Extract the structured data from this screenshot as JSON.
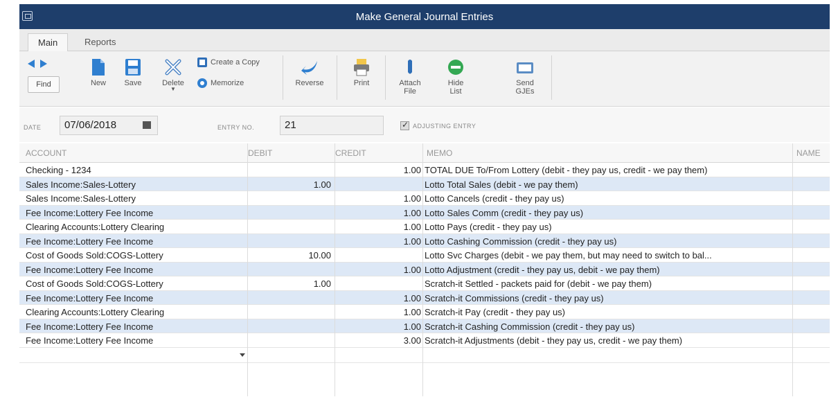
{
  "window": {
    "title": "Make General Journal Entries"
  },
  "tabs": [
    {
      "label": "Main"
    },
    {
      "label": "Reports"
    }
  ],
  "toolbar": {
    "find": "Find",
    "new": "New",
    "save": "Save",
    "delete": "Delete",
    "create_copy": "Create a Copy",
    "memorize": "Memorize",
    "reverse": "Reverse",
    "print": "Print",
    "attach_line1": "Attach",
    "attach_line2": "File",
    "hide_line1": "Hide",
    "hide_line2": "List",
    "send_line1": "Send",
    "send_line2": "GJEs"
  },
  "header": {
    "date_label": "DATE",
    "date_value": "07/06/2018",
    "entry_label": "ENTRY NO.",
    "entry_value": "21",
    "adjusting_label": "ADJUSTING ENTRY",
    "adjusting_checked": true
  },
  "columns": {
    "account": "ACCOUNT",
    "debit": "DEBIT",
    "credit": "CREDIT",
    "memo": "MEMO",
    "name": "NAME"
  },
  "rows": [
    {
      "account": "Checking  - 1234",
      "debit": "",
      "credit": "1.00",
      "memo": "TOTAL DUE To/From Lottery (debit - they pay us, credit - we pay them)"
    },
    {
      "account": "Sales Income:Sales-Lottery",
      "debit": "1.00",
      "credit": "",
      "memo": "Lotto Total Sales (debit - we pay them)"
    },
    {
      "account": "Sales Income:Sales-Lottery",
      "debit": "",
      "credit": "1.00",
      "memo": "Lotto Cancels (credit - they pay us)"
    },
    {
      "account": "Fee Income:Lottery Fee Income",
      "debit": "",
      "credit": "1.00",
      "memo": "Lotto Sales Comm (credit - they pay us)"
    },
    {
      "account": "Clearing Accounts:Lottery Clearing",
      "debit": "",
      "credit": "1.00",
      "memo": "Lotto Pays (credit - they pay us)"
    },
    {
      "account": "Fee Income:Lottery Fee Income",
      "debit": "",
      "credit": "1.00",
      "memo": "Lotto Cashing Commission (credit - they pay us)"
    },
    {
      "account": "Cost of Goods Sold:COGS-Lottery",
      "debit": "10.00",
      "credit": "",
      "memo": "Lotto Svc Charges (debit - we pay them, but may need to switch to bal..."
    },
    {
      "account": "Fee Income:Lottery Fee Income",
      "debit": "",
      "credit": "1.00",
      "memo": "Lotto Adjustment (credit - they pay us, debit - we pay them)"
    },
    {
      "account": "Cost of Goods Sold:COGS-Lottery",
      "debit": "1.00",
      "credit": "",
      "memo": "Scratch-it Settled - packets paid for (debit - we pay them)"
    },
    {
      "account": "Fee Income:Lottery Fee Income",
      "debit": "",
      "credit": "1.00",
      "memo": "Scratch-it Commissions (credit - they pay us)"
    },
    {
      "account": "Clearing Accounts:Lottery Clearing",
      "debit": "",
      "credit": "1.00",
      "memo": "Scratch-it Pay (credit - they pay us)"
    },
    {
      "account": "Fee Income:Lottery Fee Income",
      "debit": "",
      "credit": "1.00",
      "memo": "Scratch-it Cashing Commission (credit - they pay us)"
    },
    {
      "account": "Fee Income:Lottery Fee Income",
      "debit": "",
      "credit": "3.00",
      "memo": "Scratch-it Adjustments (debit - they pay us, credit - we pay them)"
    }
  ],
  "colors": {
    "titlebar": "#1e3e6b",
    "row_alt": "#dde8f6"
  }
}
